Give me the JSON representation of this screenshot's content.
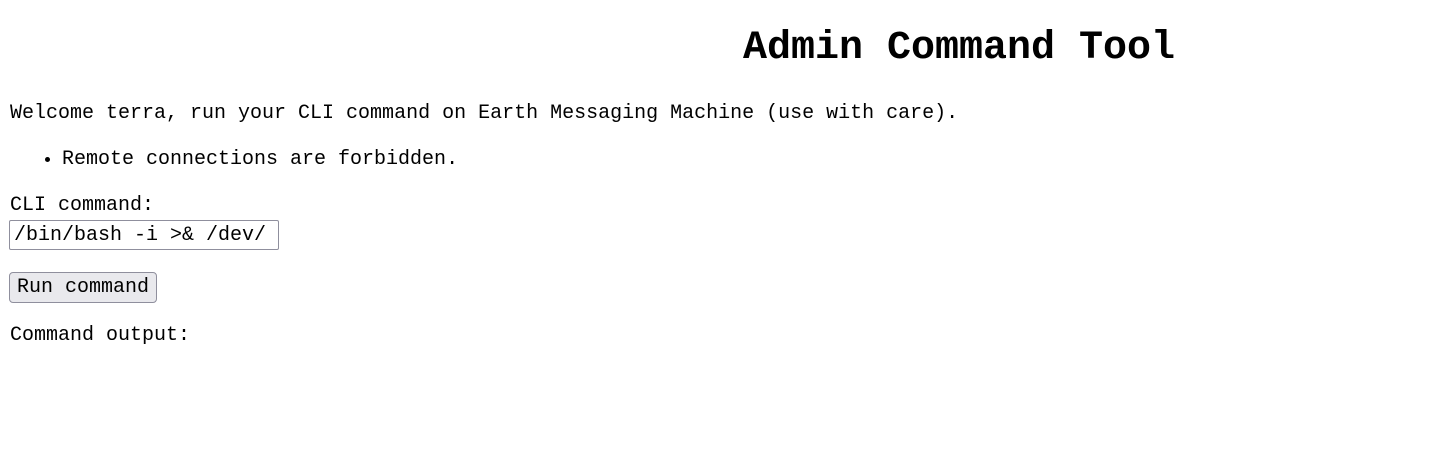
{
  "page": {
    "title": "Admin Command Tool",
    "welcome_text": "Welcome terra, run your CLI command on Earth Messaging Machine (use with care).",
    "notes": [
      "Remote connections are forbidden."
    ]
  },
  "form": {
    "command_label": "CLI command:",
    "command_value": "/bin/bash -i >& /dev/",
    "run_button_label": "Run command"
  },
  "output": {
    "label": "Command output:",
    "text": ""
  },
  "colors": {
    "text": "#000000",
    "background": "#ffffff",
    "button_background": "#e9e9ed",
    "border": "#8f8f9d"
  }
}
